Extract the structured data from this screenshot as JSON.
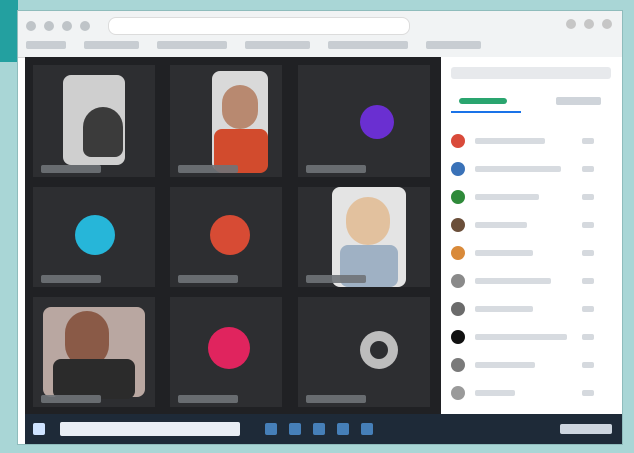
{
  "colors": {
    "background": "#a9d6d6",
    "video_bg": "#202124",
    "sidebar_bg": "#ffffff",
    "taskbar_bg": "#1e2a38",
    "tab_accent": "#1a73e8",
    "tab_green": "#2aa56f"
  },
  "icons": {
    "browser": [
      "back-icon",
      "forward-icon",
      "refresh-icon",
      "home-icon"
    ],
    "taskbar": [
      "start-icon",
      "search-icon",
      "meet-icon",
      "mail-icon",
      "explorer-icon",
      "browser-icon"
    ]
  },
  "video_tiles": [
    {
      "name": "participant-tile-1",
      "type": "video"
    },
    {
      "name": "participant-tile-2",
      "type": "video"
    },
    {
      "name": "participant-tile-3",
      "type": "avatar",
      "avatar_color": "#6a2fd1"
    },
    {
      "name": "participant-tile-4",
      "type": "avatar",
      "avatar_color": "#26b6d9"
    },
    {
      "name": "participant-tile-5",
      "type": "avatar",
      "avatar_color": "#d74b34"
    },
    {
      "name": "participant-tile-6",
      "type": "video"
    },
    {
      "name": "participant-tile-7",
      "type": "video"
    },
    {
      "name": "participant-tile-8",
      "type": "avatar",
      "avatar_color": "#e0245e"
    },
    {
      "name": "participant-tile-9",
      "type": "avatar",
      "avatar_color": "#bdbdbd"
    }
  ],
  "participants_list": [
    {
      "avatar_color": "#d94a3a"
    },
    {
      "avatar_color": "#3a72b8"
    },
    {
      "avatar_color": "#2f8a3a"
    },
    {
      "avatar_color": "#6b4f3a"
    },
    {
      "avatar_color": "#d98a3a"
    },
    {
      "avatar_color": "#8a8a8a"
    },
    {
      "avatar_color": "#6b6b6b"
    },
    {
      "avatar_color": "#111111"
    },
    {
      "avatar_color": "#7a7a7a"
    },
    {
      "avatar_color": "#9a9a9a"
    }
  ]
}
